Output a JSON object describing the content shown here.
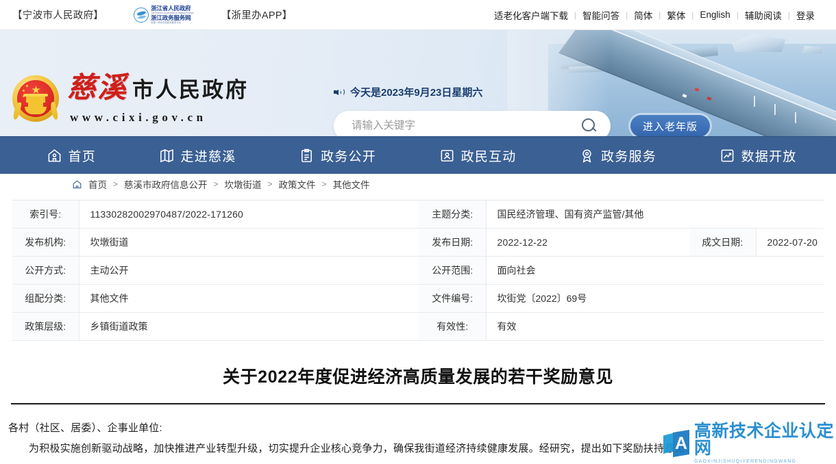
{
  "topbar": {
    "left_links": [
      "【宁波市人民政府】",
      "【浙里办APP】"
    ],
    "zj_logo": {
      "line1": "浙江省人民政府",
      "line1_en": "The People's Government of Zhejiang Province",
      "line2": "浙江政务服务网",
      "line2_en": "全国一体化在线政务服务平台"
    },
    "right_links": [
      "适老化客户端下载",
      "智能问答",
      "简体",
      "繁体",
      "English",
      "辅助阅读",
      "登录"
    ],
    "separator": "|"
  },
  "header": {
    "title_accent": "慈溪",
    "title_rest": "市人民政府",
    "url": "www.cixi.gov.cn",
    "date_text": "今天是2023年9月23日星期六",
    "search_placeholder": "请输入关键字",
    "search_value": "",
    "elder_button": "进入老年版",
    "emblem_name": "national-emblem"
  },
  "nav": {
    "items": [
      {
        "label": "首页",
        "icon": "home-icon"
      },
      {
        "label": "走进慈溪",
        "icon": "map-icon"
      },
      {
        "label": "政务公开",
        "icon": "clipboard-icon"
      },
      {
        "label": "政民互动",
        "icon": "user-card-icon"
      },
      {
        "label": "政务服务",
        "icon": "award-icon"
      },
      {
        "label": "数据开放",
        "icon": "chart-up-icon"
      }
    ],
    "bg_color": "#3b6093"
  },
  "breadcrumb": {
    "home_icon": "home-icon",
    "items": [
      "首页",
      "慈溪市政府信息公开",
      "坎墩街道",
      "政策文件",
      "其他文件"
    ],
    "separator": ">"
  },
  "info_table": {
    "rows": [
      {
        "left_label": "索引号:",
        "left_value": "11330282002970487/2022-171260",
        "right_label": "主题分类:",
        "right_value": "国民经济管理、国有资产监管/其他"
      },
      {
        "left_label": "发布机构:",
        "left_value": "坎墩街道",
        "right_label": "发布日期:",
        "right_value": "2022-12-22",
        "extra_label": "成文日期:",
        "extra_value": "2022-07-20"
      },
      {
        "left_label": "公开方式:",
        "left_value": "主动公开",
        "right_label": "公开范围:",
        "right_value": "面向社会"
      },
      {
        "left_label": "组配分类:",
        "left_value": "其他文件",
        "right_label": "文件编号:",
        "right_value": "坎街党〔2022〕69号"
      },
      {
        "left_label": "政策层级:",
        "left_value": "乡镇街道政策",
        "right_label": "有效性:",
        "right_value": "有效"
      }
    ]
  },
  "document": {
    "title": "关于2022年度促进经济高质量发展的若干奖励意见",
    "salutation": "各村（社区、居委）、企事业单位:",
    "paragraph1": "为积极实施创新驱动战略，加快推进产业转型升级，切实提升企业核心竞争力，确保我街道经济持续健康发展。经研究，提出如下奖励扶持意见:"
  },
  "watermark": {
    "letter": "A",
    "chinese": "高新技术企业认定网",
    "english": "GAOXINJISHUQIYERENDINGWANG",
    "color": "#1a86cd"
  }
}
